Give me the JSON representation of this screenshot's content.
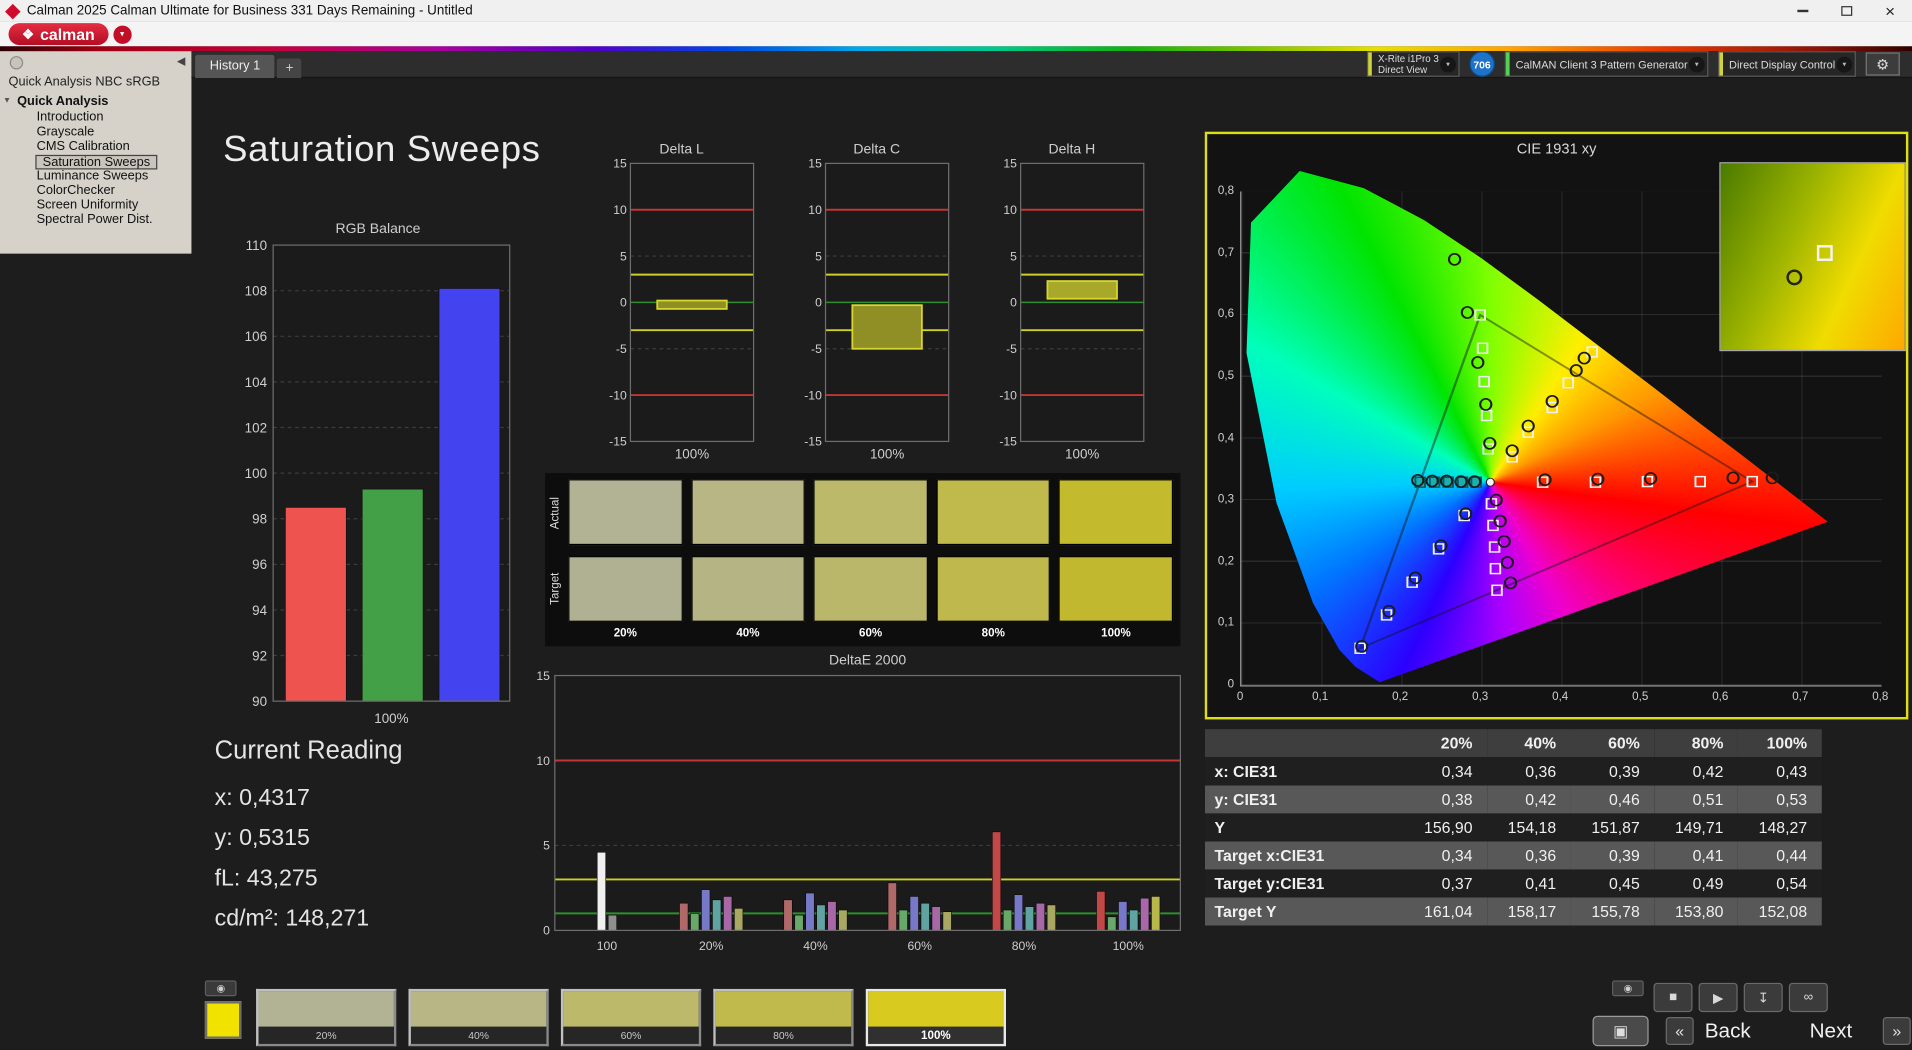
{
  "window": {
    "title": "Calman 2025 Calman Ultimate for Business 331 Days Remaining  - Untitled"
  },
  "brand": {
    "name": "calman"
  },
  "icons": {
    "dropdown": "▾",
    "collapse": "◀",
    "gear": "⚙",
    "logo_mark": "❖",
    "close": "×",
    "tree_caret": "▾",
    "eye": "◉",
    "stop": "■",
    "play": "▶",
    "save": "↧",
    "loop": "∞",
    "pattern_window": "▣",
    "back": "«",
    "next": "»",
    "add": "+"
  },
  "tabbar": {
    "history_tab": "History 1",
    "add_tab": "+"
  },
  "devices": {
    "meter_line1": "X-Rite i1Pro 3",
    "meter_line2": "Direct View",
    "badge": "706",
    "pattern_generator": "CalMAN Client 3 Pattern Generator",
    "display_control": "Direct Display Control"
  },
  "sidebar": {
    "header": "Quick Analysis NBC sRGB",
    "root": "Quick Analysis",
    "items": [
      "Introduction",
      "Grayscale",
      "CMS Calibration",
      "Saturation Sweeps",
      "Luminance Sweeps",
      "ColorChecker",
      "Screen Uniformity",
      "Spectral Power Dist."
    ],
    "selected_index": 3
  },
  "page": {
    "title": "Saturation Sweeps"
  },
  "reading": {
    "title": "Current Reading",
    "lines": [
      "x: 0,4317",
      "y: 0,5315",
      "fL: 43,275",
      "cd/m²: 148,271"
    ]
  },
  "patch_grid": {
    "row_labels": [
      "Actual",
      "Target"
    ],
    "col_labels": [
      "20%",
      "40%",
      "60%",
      "80%",
      "100%"
    ],
    "actual_colors": [
      "#b2b295",
      "#b8b685",
      "#bcb96a",
      "#c0ba4d",
      "#c3ba2e"
    ],
    "target_colors": [
      "#b0b092",
      "#b5b485",
      "#bab76a",
      "#beb84d",
      "#c1b830"
    ]
  },
  "bottom_bar": {
    "swatch_color": "#f2e200",
    "patches": [
      {
        "label": "20%",
        "color": "#b2b295",
        "selected": false
      },
      {
        "label": "40%",
        "color": "#b8b685",
        "selected": false
      },
      {
        "label": "60%",
        "color": "#bcb96a",
        "selected": false
      },
      {
        "label": "80%",
        "color": "#c0ba4d",
        "selected": false
      },
      {
        "label": "100%",
        "color": "#d8ca1e",
        "selected": true
      }
    ],
    "back_label": "Back",
    "next_label": "Next"
  },
  "table": {
    "columns": [
      "20%",
      "40%",
      "60%",
      "80%",
      "100%"
    ],
    "rows": [
      {
        "label": "x: CIE31",
        "values": [
          "0,34",
          "0,36",
          "0,39",
          "0,42",
          "0,43"
        ]
      },
      {
        "label": "y: CIE31",
        "values": [
          "0,38",
          "0,42",
          "0,46",
          "0,51",
          "0,53"
        ]
      },
      {
        "label": "Y",
        "values": [
          "156,90",
          "154,18",
          "151,87",
          "149,71",
          "148,27"
        ]
      },
      {
        "label": "Target x:CIE31",
        "values": [
          "0,34",
          "0,36",
          "0,39",
          "0,41",
          "0,44"
        ]
      },
      {
        "label": "Target y:CIE31",
        "values": [
          "0,37",
          "0,41",
          "0,45",
          "0,49",
          "0,54"
        ]
      },
      {
        "label": "Target Y",
        "values": [
          "161,04",
          "158,17",
          "155,78",
          "153,80",
          "152,08"
        ]
      }
    ]
  },
  "chart_data": [
    {
      "id": "rgb-balance",
      "type": "bar",
      "title": "RGB Balance",
      "xlabel": "100%",
      "categories": [
        "Red",
        "Green",
        "Blue"
      ],
      "values": [
        98.5,
        99.3,
        108.1
      ],
      "colors": [
        "#ef5350",
        "#43a047",
        "#4343f0"
      ],
      "ylim": [
        90,
        110
      ],
      "ytick": 2
    },
    {
      "id": "delta-l",
      "type": "range-bar",
      "title": "Delta L",
      "xlabel": "100%",
      "ylim": [
        -15,
        15
      ],
      "ytick": 5,
      "bar": {
        "from": -0.7,
        "to": 0.2,
        "fill": "#8f8f25",
        "stroke": "#d6d62e"
      },
      "ref_lines": [
        {
          "y": 10,
          "color": "#c23535"
        },
        {
          "y": -10,
          "color": "#c23535"
        },
        {
          "y": 3,
          "color": "#cfcf27"
        },
        {
          "y": -3,
          "color": "#cfcf27"
        },
        {
          "y": 0,
          "color": "#2e8f2e"
        }
      ]
    },
    {
      "id": "delta-c",
      "type": "range-bar",
      "title": "Delta C",
      "xlabel": "100%",
      "ylim": [
        -15,
        15
      ],
      "ytick": 5,
      "bar": {
        "from": -5.0,
        "to": -0.3,
        "fill": "#8f8f25",
        "stroke": "#d6d62e"
      },
      "ref_lines": [
        {
          "y": 10,
          "color": "#c23535"
        },
        {
          "y": -10,
          "color": "#c23535"
        },
        {
          "y": 3,
          "color": "#cfcf27"
        },
        {
          "y": -3,
          "color": "#cfcf27"
        },
        {
          "y": 0,
          "color": "#2e8f2e"
        }
      ]
    },
    {
      "id": "delta-h",
      "type": "range-bar",
      "title": "Delta H",
      "xlabel": "100%",
      "ylim": [
        -15,
        15
      ],
      "ytick": 5,
      "bar": {
        "from": 0.4,
        "to": 2.3,
        "fill": "#a8a82a",
        "stroke": "#d6d62e"
      },
      "ref_lines": [
        {
          "y": 10,
          "color": "#c23535"
        },
        {
          "y": -10,
          "color": "#c23535"
        },
        {
          "y": 3,
          "color": "#cfcf27"
        },
        {
          "y": -3,
          "color": "#cfcf27"
        },
        {
          "y": 0,
          "color": "#2e8f2e"
        }
      ]
    },
    {
      "id": "deltae-2000",
      "type": "grouped-bar",
      "title": "DeltaE 2000",
      "ylim": [
        0,
        15
      ],
      "yticks": [
        0,
        5,
        10,
        15
      ],
      "ref_lines": [
        {
          "y": 10,
          "color": "#c23535"
        },
        {
          "y": 3,
          "color": "#cfcf27"
        },
        {
          "y": 1,
          "color": "#2e8f2e"
        }
      ],
      "groups": [
        {
          "label": "100",
          "bars": [
            {
              "v": 4.6,
              "color": "#f0f0f0"
            },
            {
              "v": 0.9,
              "color": "#8f8f8f"
            }
          ]
        },
        {
          "label": "20%",
          "bars": [
            {
              "v": 1.6,
              "color": "#b06868"
            },
            {
              "v": 1.0,
              "color": "#68a868"
            },
            {
              "v": 2.4,
              "color": "#7878c8"
            },
            {
              "v": 1.8,
              "color": "#5fa3a3"
            },
            {
              "v": 2.0,
              "color": "#a868a8"
            },
            {
              "v": 1.3,
              "color": "#a8a862"
            }
          ]
        },
        {
          "label": "40%",
          "bars": [
            {
              "v": 1.8,
              "color": "#b06868"
            },
            {
              "v": 0.9,
              "color": "#68a868"
            },
            {
              "v": 2.2,
              "color": "#7878c8"
            },
            {
              "v": 1.5,
              "color": "#5fa3a3"
            },
            {
              "v": 1.7,
              "color": "#a868a8"
            },
            {
              "v": 1.2,
              "color": "#a8a862"
            }
          ]
        },
        {
          "label": "60%",
          "bars": [
            {
              "v": 2.8,
              "color": "#b06868"
            },
            {
              "v": 1.2,
              "color": "#68a868"
            },
            {
              "v": 2.0,
              "color": "#7878c8"
            },
            {
              "v": 1.6,
              "color": "#5fa3a3"
            },
            {
              "v": 1.4,
              "color": "#a868a8"
            },
            {
              "v": 1.1,
              "color": "#a8a862"
            }
          ]
        },
        {
          "label": "80%",
          "bars": [
            {
              "v": 5.8,
              "color": "#c24747"
            },
            {
              "v": 1.2,
              "color": "#68a868"
            },
            {
              "v": 2.1,
              "color": "#7878c8"
            },
            {
              "v": 1.4,
              "color": "#5fa3a3"
            },
            {
              "v": 1.6,
              "color": "#a868a8"
            },
            {
              "v": 1.5,
              "color": "#a8a862"
            }
          ]
        },
        {
          "label": "100%",
          "bars": [
            {
              "v": 2.3,
              "color": "#c24747"
            },
            {
              "v": 0.8,
              "color": "#68a868"
            },
            {
              "v": 1.7,
              "color": "#7878c8"
            },
            {
              "v": 1.2,
              "color": "#5fa3a3"
            },
            {
              "v": 1.9,
              "color": "#a868a8"
            },
            {
              "v": 2.0,
              "color": "#b8b84a"
            }
          ]
        }
      ]
    },
    {
      "id": "cie-1931",
      "type": "scatter",
      "title": "CIE 1931 xy",
      "xlim": [
        0,
        0.8
      ],
      "ylim": [
        0,
        0.8
      ],
      "x_ticks": [
        "0",
        "0,1",
        "0,2",
        "0,3",
        "0,4",
        "0,5",
        "0,6",
        "0,7",
        "0,8"
      ],
      "y_ticks": [
        "0",
        "0,1",
        "0,2",
        "0,3",
        "0,4",
        "0,5",
        "0,6",
        "0,7",
        "0,8"
      ],
      "white_point": [
        0.3127,
        0.329
      ],
      "srgb_triangle": [
        [
          0.64,
          0.33
        ],
        [
          0.3,
          0.6
        ],
        [
          0.15,
          0.06
        ]
      ],
      "sweeps": [
        {
          "name": "red",
          "targets": [
            [
              0.378,
              0.329
            ],
            [
              0.444,
              0.329
            ],
            [
              0.509,
              0.33
            ],
            [
              0.575,
              0.33
            ],
            [
              0.64,
              0.33
            ]
          ],
          "measured": [
            [
              0.381,
              0.333
            ],
            [
              0.447,
              0.334
            ],
            [
              0.513,
              0.335
            ],
            [
              0.616,
              0.336
            ],
            [
              0.665,
              0.336
            ]
          ]
        },
        {
          "name": "green",
          "targets": [
            [
              0.31,
              0.383
            ],
            [
              0.308,
              0.437
            ],
            [
              0.305,
              0.492
            ],
            [
              0.303,
              0.546
            ],
            [
              0.3,
              0.6
            ]
          ],
          "measured": [
            [
              0.312,
              0.392
            ],
            [
              0.307,
              0.455
            ],
            [
              0.297,
              0.523
            ],
            [
              0.284,
              0.604
            ],
            [
              0.268,
              0.69
            ]
          ]
        },
        {
          "name": "blue",
          "targets": [
            [
              0.28,
              0.275
            ],
            [
              0.248,
              0.221
            ],
            [
              0.215,
              0.167
            ],
            [
              0.183,
              0.114
            ],
            [
              0.15,
              0.06
            ]
          ],
          "measured": [
            [
              0.282,
              0.278
            ],
            [
              0.251,
              0.226
            ],
            [
              0.219,
              0.174
            ],
            [
              0.186,
              0.12
            ],
            [
              0.152,
              0.063
            ]
          ]
        },
        {
          "name": "yellow",
          "targets": [
            [
              0.34,
              0.37
            ],
            [
              0.36,
              0.41
            ],
            [
              0.39,
              0.45
            ],
            [
              0.41,
              0.49
            ],
            [
              0.44,
              0.54
            ]
          ],
          "measured": [
            [
              0.34,
              0.38
            ],
            [
              0.36,
              0.42
            ],
            [
              0.39,
              0.46
            ],
            [
              0.42,
              0.51
            ],
            [
              0.43,
              0.53
            ]
          ]
        },
        {
          "name": "cyan",
          "targets": [
            [
              0.295,
              0.329
            ],
            [
              0.278,
              0.329
            ],
            [
              0.26,
              0.329
            ],
            [
              0.243,
              0.329
            ],
            [
              0.225,
              0.329
            ]
          ],
          "measured": [
            [
              0.293,
              0.33
            ],
            [
              0.276,
              0.33
            ],
            [
              0.258,
              0.331
            ],
            [
              0.24,
              0.331
            ],
            [
              0.222,
              0.332
            ]
          ]
        },
        {
          "name": "magenta",
          "targets": [
            [
              0.314,
              0.294
            ],
            [
              0.316,
              0.259
            ],
            [
              0.318,
              0.224
            ],
            [
              0.319,
              0.189
            ],
            [
              0.321,
              0.154
            ]
          ],
          "measured": [
            [
              0.32,
              0.3
            ],
            [
              0.325,
              0.266
            ],
            [
              0.33,
              0.233
            ],
            [
              0.334,
              0.199
            ],
            [
              0.338,
              0.166
            ]
          ]
        }
      ]
    }
  ]
}
